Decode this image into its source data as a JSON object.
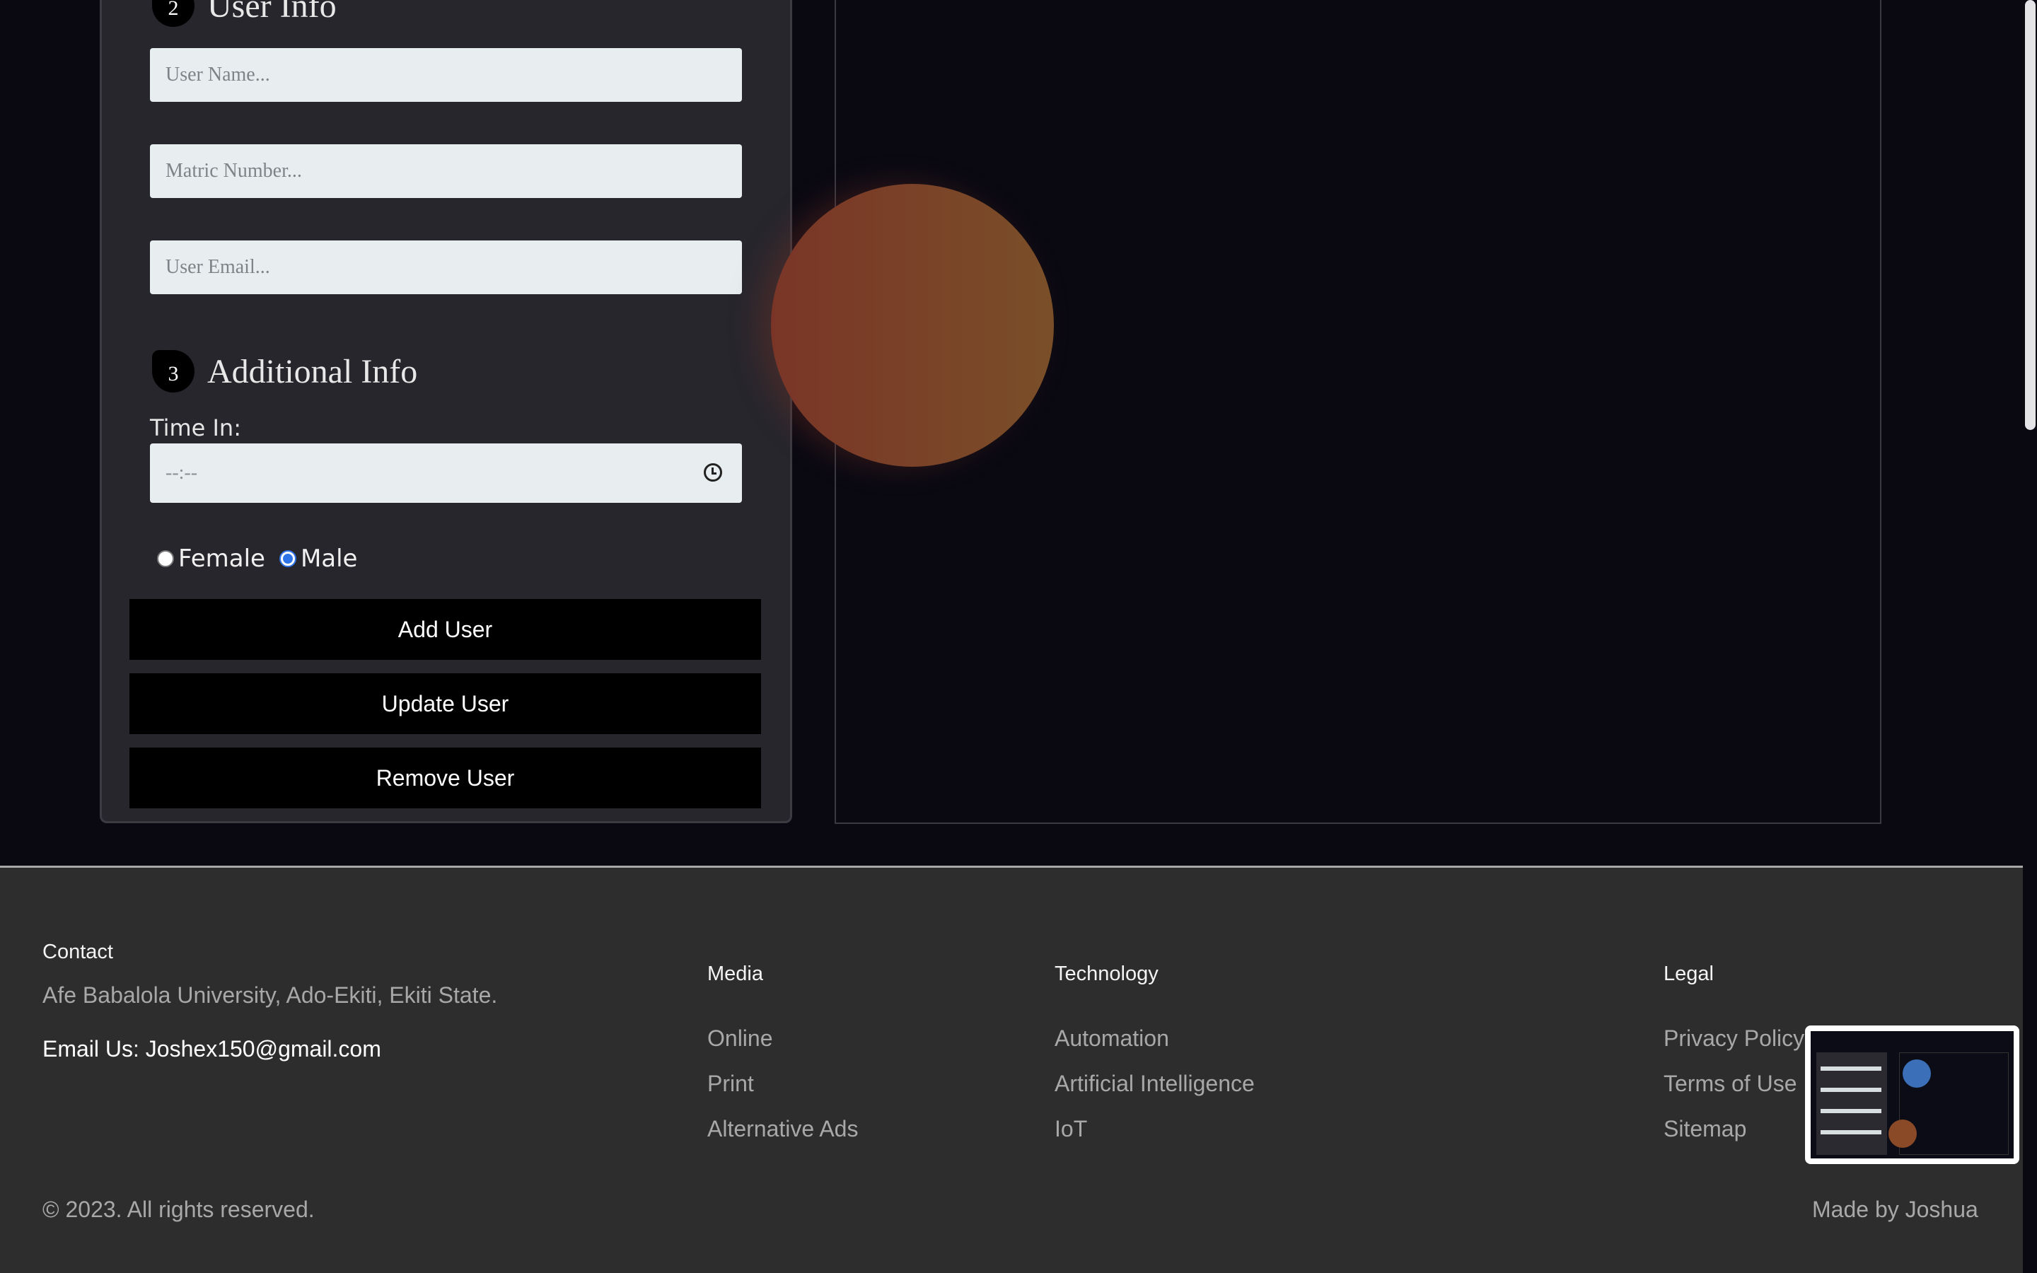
{
  "form": {
    "section2": {
      "number": "2",
      "title": "User Info"
    },
    "fields": {
      "user_name_placeholder": "User Name...",
      "matric_placeholder": "Matric Number...",
      "email_placeholder": "User Email..."
    },
    "section3": {
      "number": "3",
      "title": "Additional Info"
    },
    "time_label": "Time In:",
    "time_value": "--:--",
    "gender": {
      "options": [
        "Female",
        "Male"
      ],
      "selected": "Male"
    },
    "buttons": {
      "add": "Add User",
      "update": "Update User",
      "remove": "Remove User"
    }
  },
  "footer": {
    "contact": {
      "heading": "Contact",
      "address": "Afe Babalola University, Ado-Ekiti, Ekiti State.",
      "email_line": "Email Us: Joshex150@gmail.com"
    },
    "media": {
      "heading": "Media",
      "links": [
        "Online",
        "Print",
        "Alternative Ads"
      ]
    },
    "technology": {
      "heading": "Technology",
      "links": [
        "Automation",
        "Artificial Intelligence",
        "IoT"
      ]
    },
    "legal": {
      "heading": "Legal",
      "links": [
        "Privacy Policy",
        "Terms of Use",
        "Sitemap"
      ]
    },
    "copyright": "© 2023. All rights reserved.",
    "credit": "Made by Joshua"
  },
  "colors": {
    "page_bg": "#0a0912",
    "panel_bg": "#27262d",
    "footer_bg": "#2d2d2d",
    "button_bg": "#000000",
    "orb": "#7a3527",
    "radio_accent": "#2e73e8"
  }
}
